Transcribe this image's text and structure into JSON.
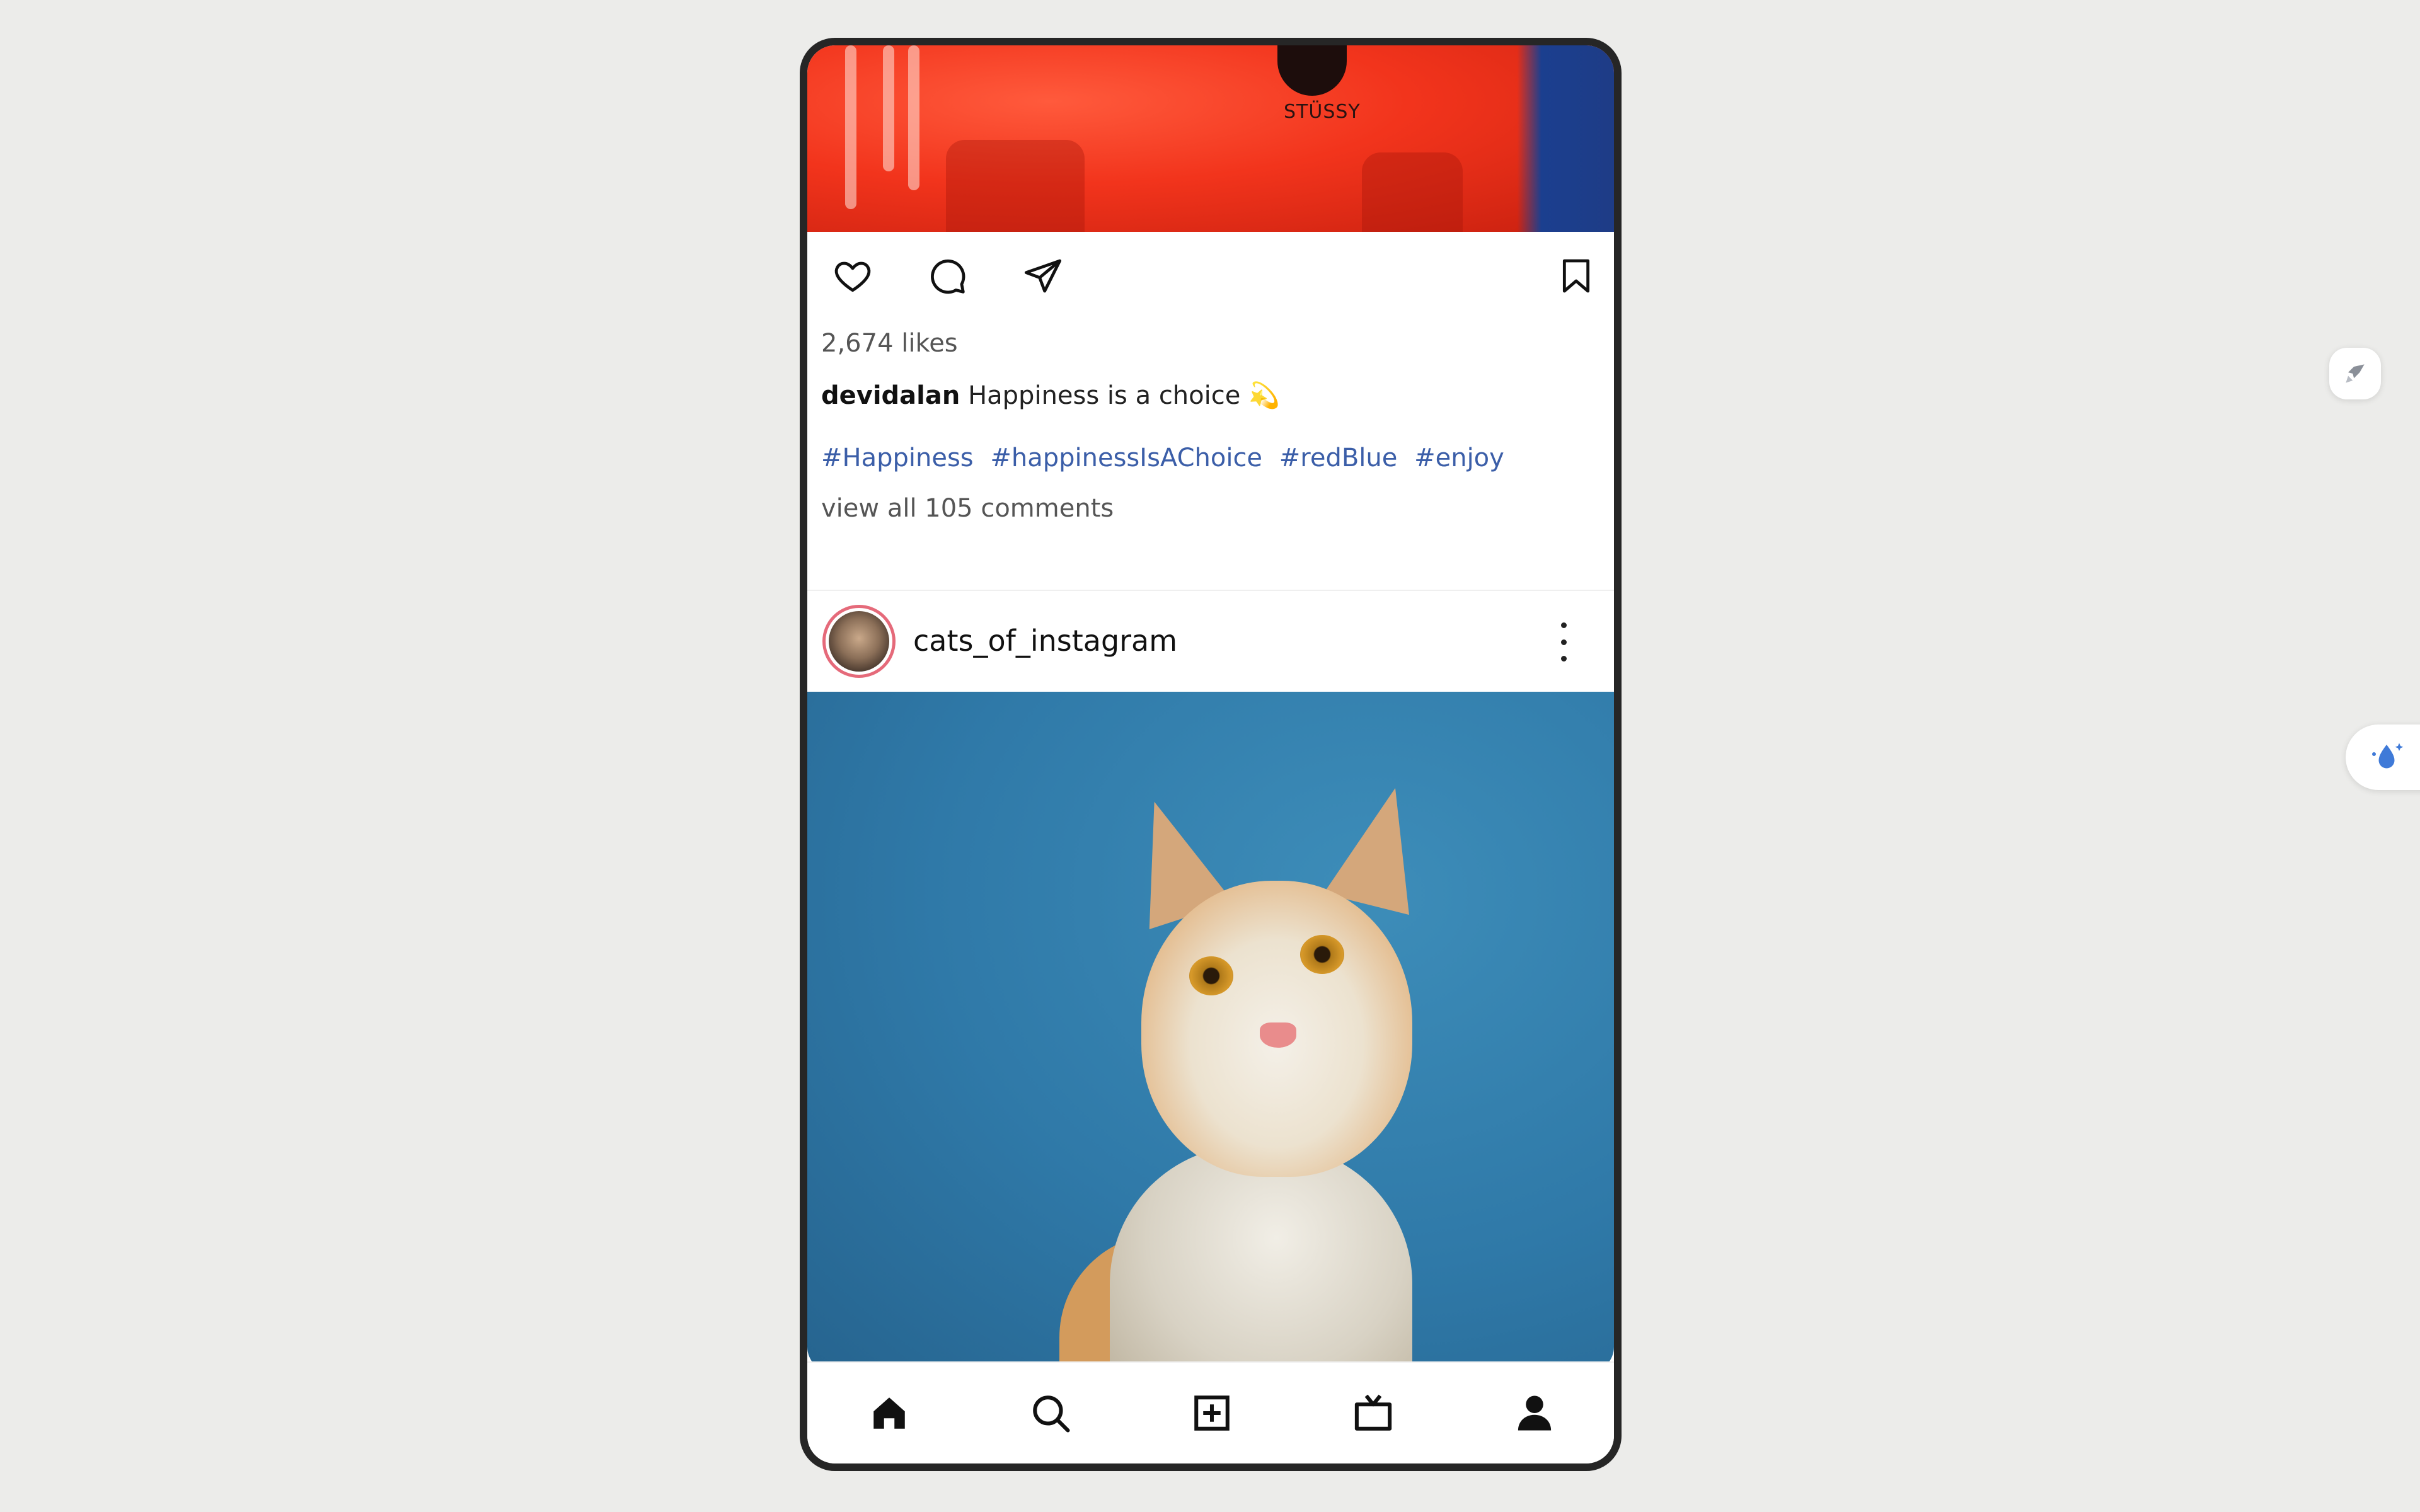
{
  "post_top": {
    "image_alt": "red shirt photo",
    "logo_text": "STÜSSY",
    "likes": "2,674 likes",
    "caption_user": "devidalan",
    "caption_text": "Happiness is a choice",
    "caption_emoji": "💫",
    "hashtags": [
      "#Happiness",
      "#happinessIsAChoice",
      "#redBlue",
      "#enjoy"
    ],
    "view_comments": "view all 105 comments"
  },
  "post_cat": {
    "username": "cats_of_instagram",
    "image_alt": "cat looking up against blue wall"
  },
  "icons": {
    "like": "heart-icon",
    "comment": "comment-icon",
    "share": "send-icon",
    "save": "bookmark-icon",
    "more": "more-vertical-icon"
  },
  "bottom_nav": [
    "home-icon",
    "search-icon",
    "add-post-icon",
    "igtv-icon",
    "profile-icon"
  ],
  "colors": {
    "background": "#ececea",
    "phone_frame": "#262626",
    "hashtag": "#3b5ea8",
    "avatar_ring": "#e56a7a",
    "text_secondary": "#555555"
  }
}
